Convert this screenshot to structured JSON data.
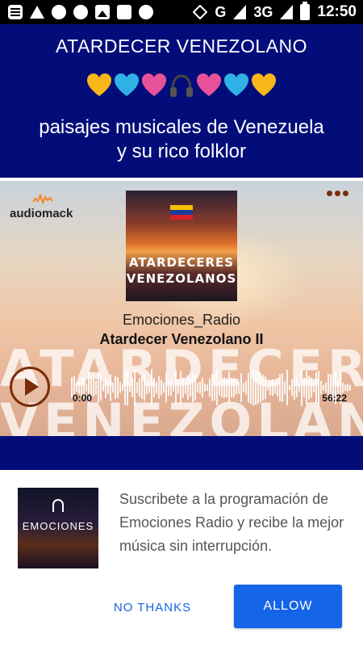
{
  "status_bar": {
    "network": "G",
    "network_3g": "3G",
    "time": "12:50",
    "left_icons": [
      "chat-icon",
      "volume-icon",
      "link-icon",
      "whatsapp-icon",
      "image-icon",
      "n-icon",
      "chat-bubble-icon"
    ],
    "right_icons": [
      "vpn-icon",
      "signal-icon",
      "signal-icon",
      "battery-charging-icon"
    ]
  },
  "header": {
    "title": "ATARDECER VENEZOLANO",
    "emojis": [
      "yellow-heart",
      "blue-heart",
      "pink-heart",
      "headphones",
      "pink-heart",
      "blue-heart",
      "yellow-heart"
    ],
    "subtitle_line1": "paisajes musicales de Venezuela",
    "subtitle_line2": "y su rico folklor",
    "background_color": "#020d7a"
  },
  "player": {
    "brand": "audiomack",
    "cover_title_line1": "ATARDECERES",
    "cover_title_line2": "VENEZOLANOS",
    "background_text_line1": "ATARDECERES",
    "background_text_line2": "VENEZOLANOS",
    "artist": "Emociones_Radio",
    "track": "Atardecer Venezolano II",
    "time_current": "0:00",
    "time_total": "56:22",
    "accent_color": "#7a2d08"
  },
  "dialog": {
    "image_name": "EMOCIONES",
    "message": "Suscribete a la programación de Emociones Radio y recibe la mejor música sin interrupción.",
    "no_thanks_label": "NO THANKS",
    "allow_label": "ALLOW",
    "button_color": "#1565e8"
  }
}
